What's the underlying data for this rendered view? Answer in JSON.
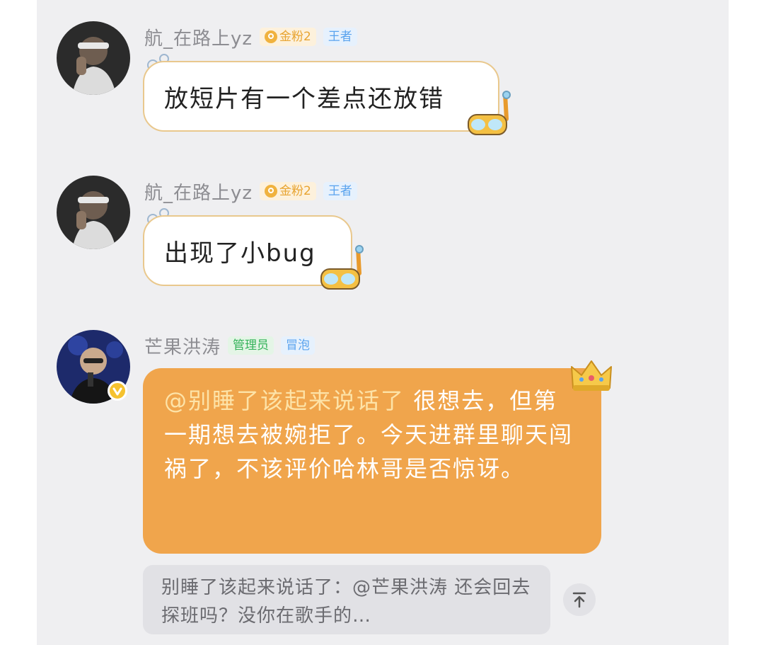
{
  "messages": [
    {
      "username": "航_在路上yz",
      "badges": [
        "金粉2",
        "王者"
      ],
      "text": "放短片有一个差点还放错"
    },
    {
      "username": "航_在路上yz",
      "badges": [
        "金粉2",
        "王者"
      ],
      "text": "出现了小bug"
    },
    {
      "username": "芒果洪涛",
      "badges": [
        "管理员",
        "冒泡"
      ],
      "mention": "@别睡了该起来说话了",
      "text": " 很想去，但第一期想去被婉拒了。今天进群里聊天闯祸了，不该评价哈林哥是否惊讶。",
      "quote": "别睡了该起来说话了：@芒果洪涛 还会回去探班吗？没你在歌手的…"
    }
  ],
  "icons": {
    "fan_badge": "fan-heart-icon",
    "bubble_decor": "snorkel-goggles-icon",
    "crown": "crown-icon",
    "verified": "verified-v-icon",
    "scroll_top": "arrow-up-to-top-icon"
  },
  "colors": {
    "bubble_border": "#e9c88d",
    "orange_bubble": "#f0a54c",
    "gold_badge": "#e8a431",
    "blue_badge": "#5aa3ee",
    "green_badge": "#35b35a"
  }
}
